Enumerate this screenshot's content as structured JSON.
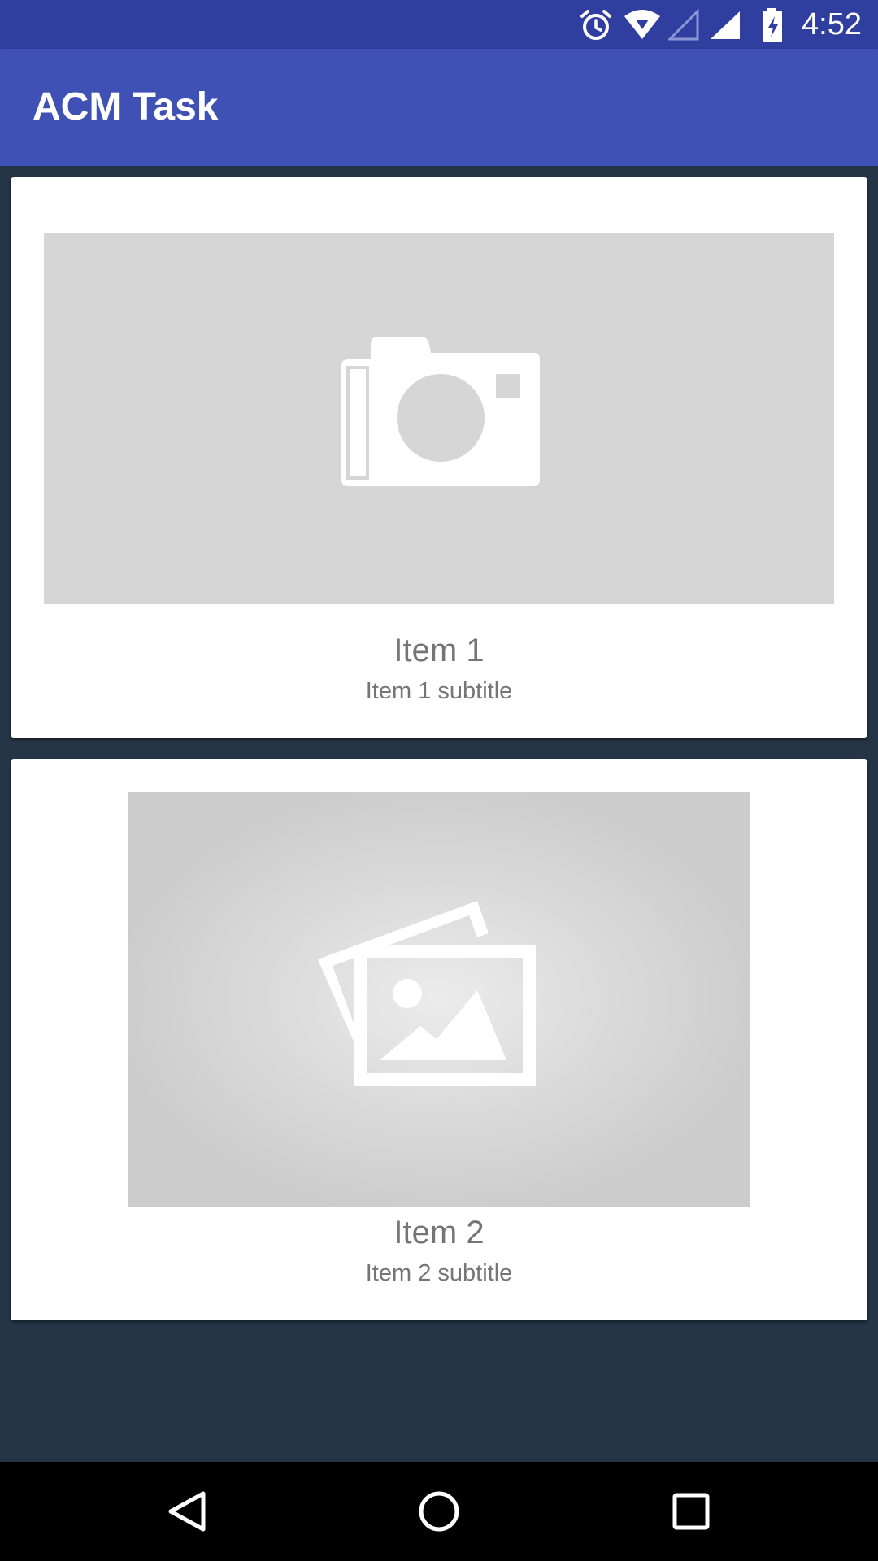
{
  "status_bar": {
    "time": "4:52",
    "icons": [
      "alarm-icon",
      "wifi-icon",
      "signal-empty-icon",
      "signal-icon",
      "battery-charging-icon"
    ]
  },
  "app_bar": {
    "title": "ACM Task"
  },
  "cards": [
    {
      "title": "Item 1",
      "subtitle": "Item 1 subtitle",
      "image_icon": "camera-placeholder-icon"
    },
    {
      "title": "Item 2",
      "subtitle": "Item 2 subtitle",
      "image_icon": "image-placeholder-icon"
    }
  ],
  "nav_bar": {
    "buttons": [
      "back-icon",
      "home-icon",
      "recents-icon"
    ]
  },
  "colors": {
    "status_bar": "#303F9F",
    "app_bar": "#3F51B5",
    "background": "#263545",
    "card": "#FFFFFF",
    "text_secondary": "#757575"
  }
}
